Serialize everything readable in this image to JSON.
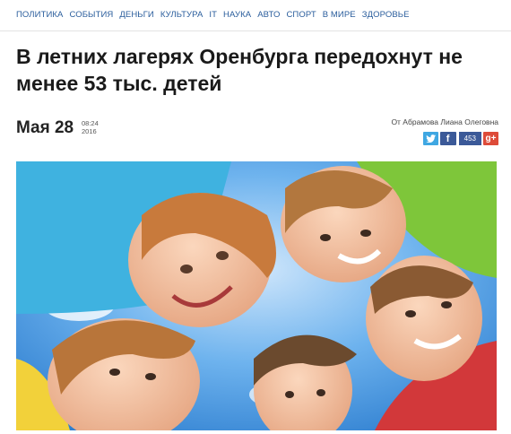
{
  "nav": {
    "items": [
      "ПОЛИТИКА",
      "СОБЫТИЯ",
      "ДЕНЬГИ",
      "КУЛЬТУРА",
      "IT",
      "НАУКА",
      "АВТО",
      "СПОРТ",
      "В МИРЕ",
      "ЗДОРОВЬЕ"
    ]
  },
  "article": {
    "title": "В летних лагерях Оренбурга передохнут не менее 53 тыс. детей",
    "date": "Мая 28",
    "time": "08:24",
    "year": "2016",
    "author": "От Абрамова Лиана Олеговна",
    "share_count": "453"
  },
  "social": {
    "twitter_icon": "twitter-icon",
    "facebook_icon": "facebook-icon",
    "gplus_icon": "google-plus-icon",
    "twitter_color": "#3fa7e2",
    "facebook_color": "#3b5998",
    "gplus_color": "#dd4b39"
  },
  "colors": {
    "link": "#2a5d9c",
    "sky": "#4a9be0"
  }
}
